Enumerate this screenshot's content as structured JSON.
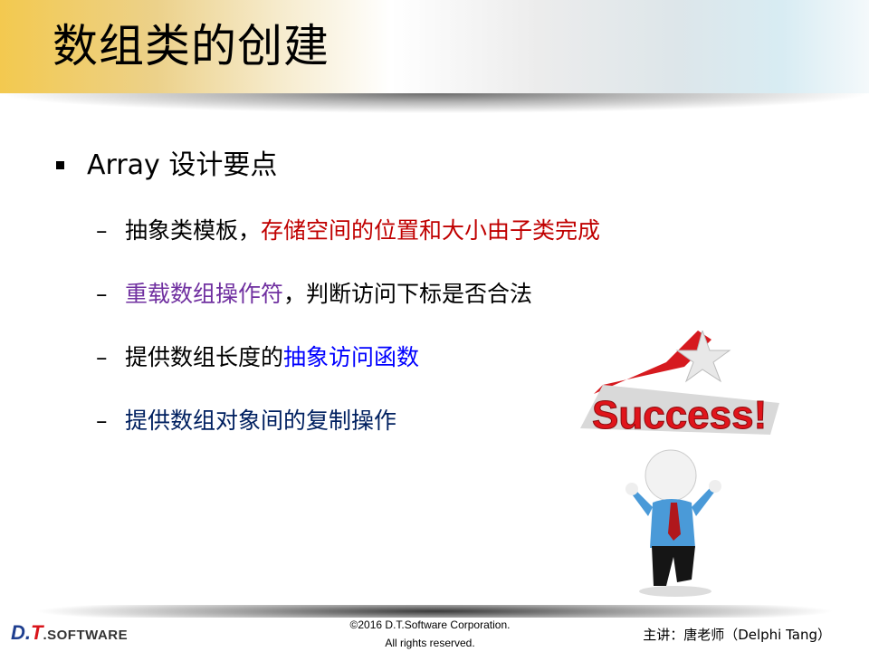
{
  "header": {
    "title": "数组类的创建"
  },
  "content": {
    "main_bullet": "Array 设计要点",
    "sub_items": [
      {
        "parts": [
          {
            "text": "抽象类模板，",
            "color": "#000000"
          },
          {
            "text": "存储空间的位置和大小由子类完成",
            "color": "#c00000"
          }
        ]
      },
      {
        "parts": [
          {
            "text": "重载数组操作符",
            "color": "#7030a0"
          },
          {
            "text": "，判断访问下标是否合法",
            "color": "#000000"
          }
        ]
      },
      {
        "parts": [
          {
            "text": "提供数组长度的",
            "color": "#000000"
          },
          {
            "text": "抽象访问函数",
            "color": "#0000ff"
          }
        ]
      },
      {
        "parts": [
          {
            "text": "提供数组对象间的复制操作",
            "color": "#002060"
          }
        ]
      }
    ],
    "dash": "–"
  },
  "illustration": {
    "word": "Success!",
    "icon": "success-figure-icon"
  },
  "footer": {
    "logo": {
      "d": "D.",
      "t": "T",
      "rest": ".SOFTWARE"
    },
    "copyright_line1": "©2016 D.T.Software Corporation.",
    "copyright_line2": "All rights reserved.",
    "lecturer": "主讲：唐老师（Delphi Tang）"
  }
}
